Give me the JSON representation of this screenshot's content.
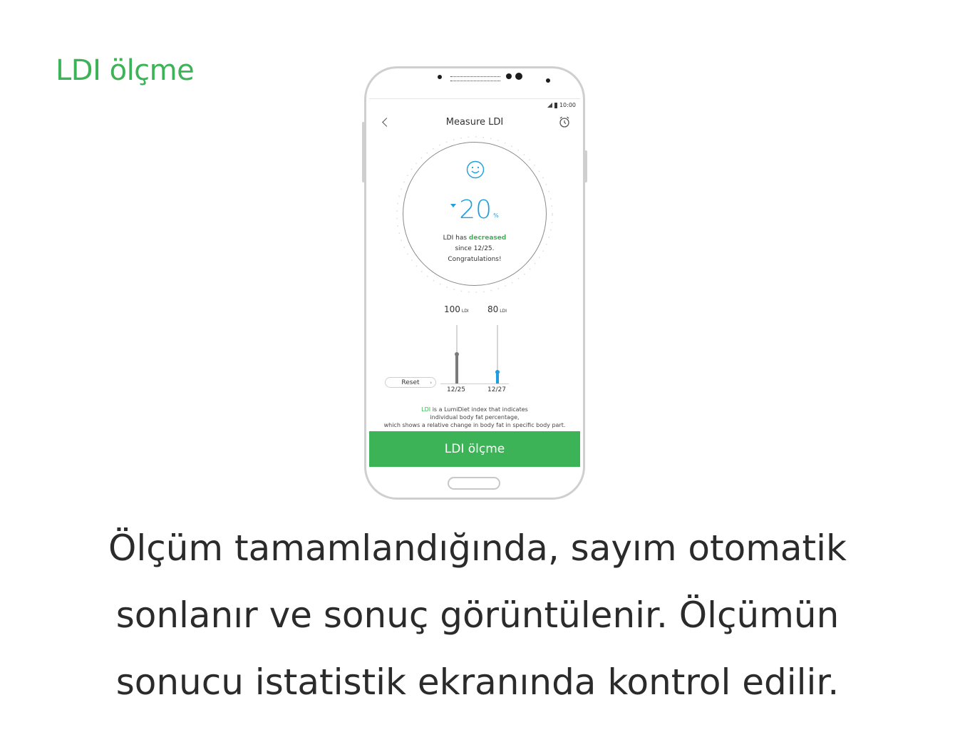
{
  "page": {
    "section_title": "LDI ölçme",
    "caption_lines": [
      "Ölçüm tamamlandığında, sayım otomatik",
      "sonlanır ve sonuç görüntülenir. Ölçümün",
      "sonucu istatistik ekranında kontrol edilir."
    ]
  },
  "status_bar": {
    "time": "10:00"
  },
  "header": {
    "title": "Measure LDI",
    "back_icon": "chevron-left-icon",
    "right_icon": "alarm-clock-icon"
  },
  "result": {
    "icon": "smiley-icon",
    "change_value": "20",
    "change_unit": "%",
    "direction": "down",
    "message_prefix": "LDI has ",
    "message_highlight": "decreased",
    "message_line2": "since 12/25.",
    "message_line3": "Congratulations!"
  },
  "comparison": {
    "bars": [
      {
        "value": "100",
        "unit": "LDI",
        "date": "12/25",
        "level": 0.5,
        "color": "#7a7a7a"
      },
      {
        "value": "80",
        "unit": "LDI",
        "date": "12/27",
        "level": 0.2,
        "color": "#1e9de0"
      }
    ],
    "reset_label": "Reset"
  },
  "info": {
    "highlight": "LDI",
    "line1_rest": " is a LumiDiet index that indicates",
    "line2": "individual body fat percentage,",
    "line3": "which shows a relative change in body fat in specific body part."
  },
  "action": {
    "button_label": "LDI ölçme"
  },
  "colors": {
    "accent_green": "#3cb356",
    "accent_blue": "#1e9de0"
  }
}
